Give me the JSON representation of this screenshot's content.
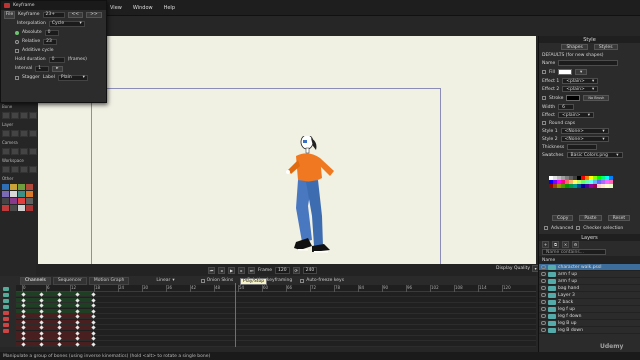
{
  "menubar": {
    "menus": [
      "View",
      "Window",
      "Help"
    ]
  },
  "keyframe_dialog": {
    "title": "Keyframe",
    "file": "File",
    "keyframe_label": "Keyframe",
    "keyframe_value": "23+",
    "interpolation_label": "Interpolation",
    "interpolation_value": "Cycle",
    "absolute_label": "Absolute",
    "absolute_value": "0",
    "relative_label": "Relative",
    "relative_value": "23",
    "additive_label": "Additive cycle",
    "hold_label": "Hold duration",
    "hold_value": "0",
    "hold_unit": "(frames)",
    "interval_label": "Interval",
    "interval_value": "1",
    "stagger_label": "Stagger",
    "label_label": "Label",
    "label_value": "Plain"
  },
  "left_tools": {
    "section_labels": [
      "Bone",
      "Layer",
      "Camera",
      "Workspace",
      "Other"
    ]
  },
  "transport": {
    "frame_label": "Frame",
    "frame_value": "120",
    "of_value": "240",
    "display_quality": "Display Quality",
    "tooltip": "Play/Stop"
  },
  "timeline": {
    "tabs": [
      "Channels",
      "Sequencer",
      "Motion Graph"
    ],
    "options": [
      "Linear",
      "Onion Skins",
      "Relative keyframing",
      "Auto-freeze keys"
    ],
    "ruler_labels": [
      "0",
      "6",
      "12",
      "18",
      "24",
      "30",
      "36",
      "42",
      "48",
      "54",
      "60",
      "66",
      "72",
      "78",
      "84",
      "90",
      "96",
      "102",
      "108",
      "114",
      "120"
    ]
  },
  "status": {
    "text": "Manipulate a group of bones (using inverse kinematics) (hold <alt> to rotate a single bone)"
  },
  "style_panel": {
    "title": "Style",
    "shapes_btn": "Shapes",
    "styles_btn": "Styles",
    "defaults_label": "DEFAULTS (for new shapes)",
    "name_label": "Name",
    "fill_label": "Fill",
    "effect1_label": "Effect 1",
    "effect1_value": "<plain>",
    "effect2_label": "Effect 2",
    "effect2_value": "<plain>",
    "stroke_label": "Stroke",
    "no_brush": "No Brush",
    "width_label": "Width",
    "width_value": "6",
    "effect_label": "Effect",
    "effect_value": "<plain>",
    "round_caps": "Round caps",
    "style1_label": "Style 1",
    "style1_value": "<None>",
    "style2_label": "Style 2",
    "style2_value": "<None>",
    "thickness_label": "Thickness",
    "swatches_label": "Swatches",
    "swatches_value": "Basic Colors.png",
    "copy": "Copy",
    "paste": "Paste",
    "reset": "Reset",
    "advanced": "Advanced",
    "checker": "Checker selection",
    "palette_colors": [
      "#ffffff",
      "#e0e0e0",
      "#c0c0c0",
      "#a0a0a0",
      "#808080",
      "#606060",
      "#404040",
      "#000000",
      "#ff0000",
      "#ff8000",
      "#ffff00",
      "#80ff00",
      "#00ff00",
      "#00ff80",
      "#00ffff",
      "#0080ff",
      "#0000ff",
      "#8000ff",
      "#ff00ff",
      "#ff0080",
      "#ff6666",
      "#ffb366",
      "#ffff66",
      "#b3ff66",
      "#66ff66",
      "#66ffb3",
      "#66ffff",
      "#66b3ff",
      "#6666ff",
      "#b366ff",
      "#ff66ff",
      "#ff66b3",
      "#990000",
      "#994d00",
      "#999900",
      "#4d9900",
      "#009900",
      "#00994d",
      "#009999",
      "#004d99",
      "#000099",
      "#4d0099",
      "#990099",
      "#99004d",
      "#ffcccc",
      "#ffe6cc",
      "#ffffcc",
      "#e6ffcc"
    ]
  },
  "layers_panel": {
    "title": "Layers",
    "search_placeholder": "Name contains...",
    "name_header": "Name",
    "layers": [
      {
        "name": "character walk.pssl",
        "selected": true
      },
      {
        "name": "arm f up",
        "selected": false
      },
      {
        "name": "arm f up",
        "selected": false
      },
      {
        "name": "bag hand",
        "selected": false
      },
      {
        "name": "Layer 3",
        "selected": false
      },
      {
        "name": "Z back",
        "selected": false
      },
      {
        "name": "leg f up",
        "selected": false
      },
      {
        "name": "leg f down",
        "selected": false
      },
      {
        "name": "leg B up",
        "selected": false
      },
      {
        "name": "leg B down",
        "selected": false
      }
    ]
  },
  "watermark": "Udemy",
  "colors": {
    "canvas_bg": "#f0f0e3",
    "frame_border": "#8c8cb8",
    "shirt_orange": "#f07820",
    "jeans_blue": "#4a78c0",
    "playhead": "#e04040",
    "layer_selected": "#3d6d9a"
  }
}
